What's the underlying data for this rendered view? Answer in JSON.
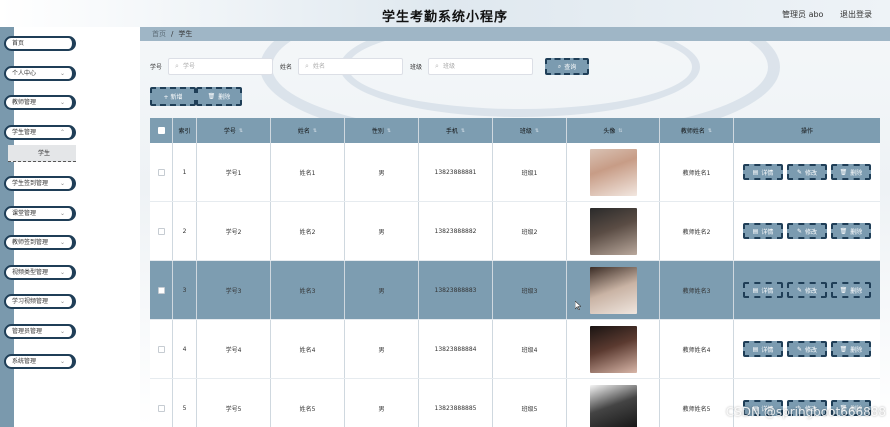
{
  "header": {
    "title": "学生考勤系统小程序",
    "user_label": "管理员 abo",
    "logout": "退出登录"
  },
  "sidebar": {
    "items": [
      {
        "label": "首页",
        "has_arrow": false
      },
      {
        "label": "个人中心",
        "has_arrow": true
      },
      {
        "label": "教师管理",
        "has_arrow": true
      },
      {
        "label": "学生管理",
        "has_arrow": true,
        "expanded": true
      },
      {
        "label": "学生签到管理",
        "has_arrow": true
      },
      {
        "label": "课堂管理",
        "has_arrow": true
      },
      {
        "label": "教师签到管理",
        "has_arrow": true
      },
      {
        "label": "视频类型管理",
        "has_arrow": true
      },
      {
        "label": "学习视频管理",
        "has_arrow": true
      },
      {
        "label": "管理员管理",
        "has_arrow": true
      },
      {
        "label": "系统管理",
        "has_arrow": true
      }
    ],
    "submenu": {
      "label": "学生"
    }
  },
  "breadcrumb": {
    "home": "首页",
    "sep": "/",
    "current": "学生"
  },
  "filters": {
    "student_no_label": "学号",
    "student_no_placeholder": "学号",
    "name_label": "姓名",
    "name_placeholder": "姓名",
    "class_label": "班级",
    "class_placeholder": "班级",
    "search_label": "查询"
  },
  "toolbar": {
    "add_label": "+ 新增",
    "delete_label": "删除"
  },
  "table": {
    "headers": [
      "索引",
      "学号",
      "姓名",
      "性别",
      "手机",
      "班级",
      "头像",
      "教师姓名",
      "操作"
    ],
    "sortable": [
      false,
      true,
      true,
      true,
      true,
      true,
      true,
      true,
      false
    ],
    "rows": [
      {
        "index": "1",
        "student_no": "学号1",
        "name": "姓名1",
        "gender": "男",
        "phone": "13823888881",
        "class": "班级1",
        "teacher": "教师姓名1",
        "selected": false
      },
      {
        "index": "2",
        "student_no": "学号2",
        "name": "姓名2",
        "gender": "男",
        "phone": "13823888882",
        "class": "班级2",
        "teacher": "教师姓名2",
        "selected": false
      },
      {
        "index": "3",
        "student_no": "学号3",
        "name": "姓名3",
        "gender": "男",
        "phone": "13823888883",
        "class": "班级3",
        "teacher": "教师姓名3",
        "selected": true
      },
      {
        "index": "4",
        "student_no": "学号4",
        "name": "姓名4",
        "gender": "男",
        "phone": "13823888884",
        "class": "班级4",
        "teacher": "教师姓名4",
        "selected": false
      },
      {
        "index": "5",
        "student_no": "学号5",
        "name": "姓名5",
        "gender": "男",
        "phone": "13823888885",
        "class": "班级5",
        "teacher": "教师姓名5",
        "selected": false
      }
    ],
    "actions": {
      "detail": "详情",
      "edit": "修改",
      "delete": "删除"
    }
  },
  "watermark": "CSDN @springboot666888",
  "colors": {
    "accent": "#7d9db1",
    "border_dark": "#1f3e57",
    "breadcrumb_bg": "#9fb6c6"
  }
}
